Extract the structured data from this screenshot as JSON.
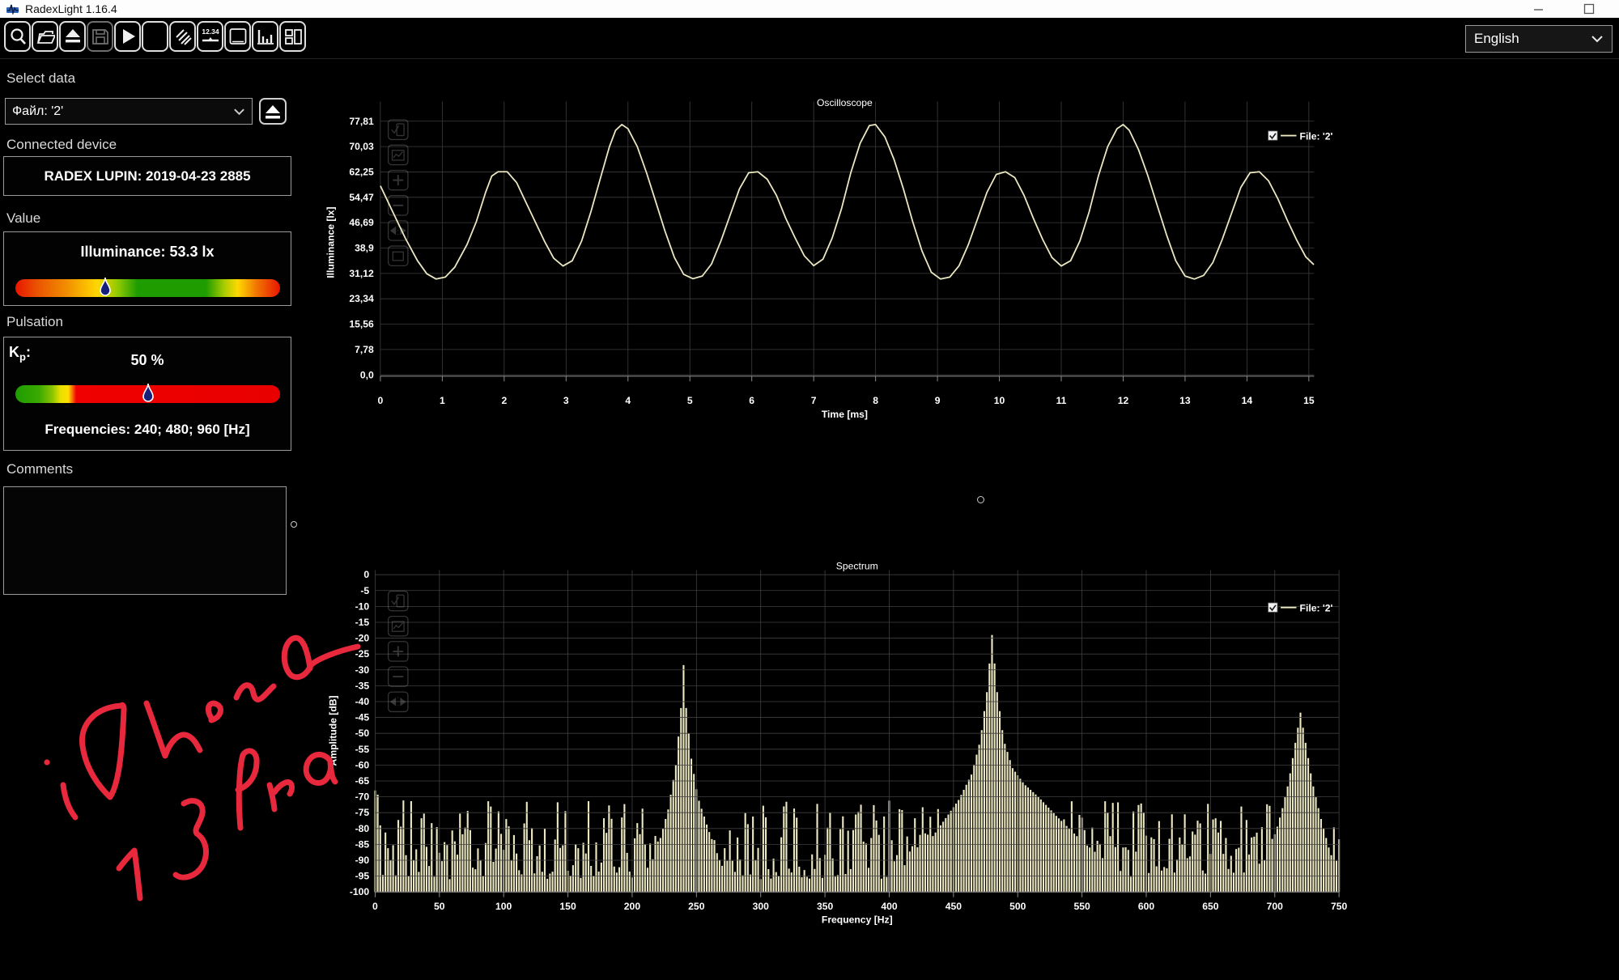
{
  "window": {
    "title": "RadexLight 1.16.4"
  },
  "toolbar": {
    "buttons": [
      {
        "name": "zoom-search",
        "disabled": false
      },
      {
        "name": "open-file",
        "disabled": false
      },
      {
        "name": "eject-device",
        "disabled": false
      },
      {
        "name": "save",
        "disabled": true
      },
      {
        "name": "play",
        "disabled": false
      },
      {
        "name": "waveform-mode",
        "disabled": false
      },
      {
        "name": "hatch-filter",
        "disabled": false
      },
      {
        "name": "value-display",
        "disabled": false,
        "text": "12.34"
      },
      {
        "name": "oscilloscope-view",
        "disabled": false
      },
      {
        "name": "spectrum-view",
        "disabled": false
      },
      {
        "name": "panel-layout",
        "disabled": false
      }
    ],
    "language": {
      "value": "English"
    }
  },
  "sidebar": {
    "select_data_label": "Select data",
    "file_select_value": "Файл: '2'",
    "connected_device_label": "Connected device",
    "device_name": "RADEX LUPIN: 2019-04-23 2885",
    "value_label": "Value",
    "illuminance_text": "Illuminance: 53.3 lx",
    "illuminance_marker_pos": 0.34,
    "pulsation_label": "Pulsation",
    "kp_k": "K",
    "kp_sub": "p",
    "kp_colon": ":",
    "kp_value": "50 %",
    "kp_marker_pos": 0.5,
    "frequencies_text": "Frequencies: 240; 480; 960 [Hz]",
    "comments_label": "Comments",
    "comments_value": ""
  },
  "annotation": {
    "text": "iPhone 13Pro",
    "color": "#e8283c"
  },
  "chart_data": [
    {
      "type": "line",
      "title": "Oscilloscope",
      "xlabel": "Time [ms]",
      "ylabel": "Illuminance [lx]",
      "xlim": [
        0,
        15.1
      ],
      "ylim": [
        0,
        84
      ],
      "grid": true,
      "x_ticks": [
        0,
        1,
        2,
        3,
        4,
        5,
        6,
        7,
        8,
        9,
        10,
        11,
        12,
        13,
        14,
        15
      ],
      "y_tick_values": [
        0,
        7.78,
        15.56,
        23.34,
        31.12,
        38.9,
        46.69,
        54.47,
        62.25,
        70.03,
        77.81
      ],
      "y_tick_labels": [
        "0,0",
        "7,78",
        "15,56",
        "23,34",
        "31,12",
        "38,9",
        "46,69",
        "54,47",
        "62,25",
        "70,03",
        "77,81"
      ],
      "legend": {
        "label": "File: '2'",
        "checked": true,
        "position": "top-right"
      },
      "series_color": "#ece8c2",
      "legend_text_color": "#e7e3b4",
      "points": [
        [
          0,
          58
        ],
        [
          0.2,
          50
        ],
        [
          0.4,
          42
        ],
        [
          0.6,
          35
        ],
        [
          0.75,
          31
        ],
        [
          0.9,
          29.4
        ],
        [
          1.05,
          30
        ],
        [
          1.2,
          33
        ],
        [
          1.4,
          40
        ],
        [
          1.55,
          47
        ],
        [
          1.7,
          56
        ],
        [
          1.8,
          61
        ],
        [
          1.9,
          62.3
        ],
        [
          2.05,
          62.3
        ],
        [
          2.2,
          59
        ],
        [
          2.35,
          53
        ],
        [
          2.5,
          47
        ],
        [
          2.65,
          41
        ],
        [
          2.8,
          35.8
        ],
        [
          2.95,
          33.4
        ],
        [
          3.1,
          35
        ],
        [
          3.25,
          41
        ],
        [
          3.4,
          50
        ],
        [
          3.55,
          60
        ],
        [
          3.7,
          70
        ],
        [
          3.8,
          75
        ],
        [
          3.9,
          76.8
        ],
        [
          4,
          75.5
        ],
        [
          4.15,
          70
        ],
        [
          4.3,
          62
        ],
        [
          4.45,
          53
        ],
        [
          4.6,
          44
        ],
        [
          4.75,
          36
        ],
        [
          4.9,
          30.8
        ],
        [
          5.05,
          29.5
        ],
        [
          5.2,
          30.3
        ],
        [
          5.35,
          34
        ],
        [
          5.5,
          41
        ],
        [
          5.65,
          49
        ],
        [
          5.8,
          57
        ],
        [
          5.95,
          62
        ],
        [
          6.1,
          62.3
        ],
        [
          6.25,
          60
        ],
        [
          6.4,
          55
        ],
        [
          6.55,
          48
        ],
        [
          6.7,
          42
        ],
        [
          6.85,
          36.5
        ],
        [
          7,
          33.5
        ],
        [
          7.15,
          35.5
        ],
        [
          7.3,
          42
        ],
        [
          7.45,
          51
        ],
        [
          7.6,
          62
        ],
        [
          7.75,
          71
        ],
        [
          7.9,
          76.5
        ],
        [
          8,
          76.8
        ],
        [
          8.15,
          73
        ],
        [
          8.3,
          66
        ],
        [
          8.45,
          57
        ],
        [
          8.6,
          47
        ],
        [
          8.75,
          38
        ],
        [
          8.9,
          31.5
        ],
        [
          9.05,
          29.4
        ],
        [
          9.2,
          30
        ],
        [
          9.35,
          33.5
        ],
        [
          9.5,
          40
        ],
        [
          9.65,
          48
        ],
        [
          9.8,
          56
        ],
        [
          9.95,
          61.5
        ],
        [
          10.1,
          62.3
        ],
        [
          10.25,
          60.5
        ],
        [
          10.4,
          55
        ],
        [
          10.55,
          48
        ],
        [
          10.7,
          41.5
        ],
        [
          10.85,
          36
        ],
        [
          11,
          33.4
        ],
        [
          11.15,
          35
        ],
        [
          11.3,
          41
        ],
        [
          11.45,
          50
        ],
        [
          11.6,
          61
        ],
        [
          11.75,
          70
        ],
        [
          11.9,
          75.5
        ],
        [
          12,
          76.8
        ],
        [
          12.1,
          75
        ],
        [
          12.25,
          69
        ],
        [
          12.4,
          61
        ],
        [
          12.55,
          52
        ],
        [
          12.7,
          43
        ],
        [
          12.85,
          35
        ],
        [
          13,
          30.3
        ],
        [
          13.15,
          29.4
        ],
        [
          13.3,
          30.5
        ],
        [
          13.45,
          34.5
        ],
        [
          13.6,
          41.5
        ],
        [
          13.75,
          49.5
        ],
        [
          13.9,
          57.5
        ],
        [
          14.05,
          62
        ],
        [
          14.2,
          62.3
        ],
        [
          14.35,
          59.5
        ],
        [
          14.5,
          54
        ],
        [
          14.65,
          47.5
        ],
        [
          14.8,
          41.5
        ],
        [
          14.95,
          36.2
        ],
        [
          15.08,
          33.8
        ]
      ]
    },
    {
      "type": "bar",
      "title": "Spectrum",
      "xlabel": "Frequency [Hz]",
      "ylabel": "Amplitude [dB]",
      "xlim": [
        0,
        750
      ],
      "ylim": [
        -100,
        0
      ],
      "grid": true,
      "x_ticks": [
        0,
        50,
        100,
        150,
        200,
        250,
        300,
        350,
        400,
        450,
        500,
        550,
        600,
        650,
        700,
        750
      ],
      "y_ticks": [
        0,
        -5,
        -10,
        -15,
        -20,
        -25,
        -30,
        -35,
        -40,
        -45,
        -50,
        -55,
        -60,
        -65,
        -70,
        -75,
        -80,
        -85,
        -90,
        -95,
        -100
      ],
      "legend": {
        "label": "File: '2'",
        "checked": true,
        "position": "top-right"
      },
      "series_color": "#ece8c2",
      "legend_text_color": "#e7e3b4",
      "bar_step_hz": 2,
      "noise_floor_db": [
        -96,
        -71
      ],
      "peaks": [
        {
          "hz": 240,
          "db": -28.5
        },
        {
          "hz": 480,
          "db": -19
        },
        {
          "hz": 720,
          "db": -43.5
        }
      ],
      "envelope": [
        [
          0,
          -68
        ],
        [
          3,
          -70
        ],
        [
          6,
          -97
        ],
        [
          85,
          -97
        ],
        [
          89,
          -71
        ],
        [
          93,
          -97
        ],
        [
          208,
          -97
        ],
        [
          220,
          -86
        ],
        [
          228,
          -74
        ],
        [
          234,
          -60
        ],
        [
          238,
          -42
        ],
        [
          240,
          -28.5
        ],
        [
          242,
          -42
        ],
        [
          246,
          -58
        ],
        [
          251,
          -70
        ],
        [
          259,
          -80
        ],
        [
          268,
          -90
        ],
        [
          276,
          -97
        ],
        [
          408,
          -97
        ],
        [
          424,
          -88
        ],
        [
          440,
          -79
        ],
        [
          454,
          -71
        ],
        [
          464,
          -63
        ],
        [
          471,
          -52
        ],
        [
          476,
          -37
        ],
        [
          480,
          -19
        ],
        [
          484,
          -37
        ],
        [
          489,
          -52
        ],
        [
          496,
          -61
        ],
        [
          505,
          -66
        ],
        [
          516,
          -70
        ],
        [
          530,
          -76
        ],
        [
          550,
          -84
        ],
        [
          574,
          -92
        ],
        [
          596,
          -97
        ],
        [
          678,
          -97
        ],
        [
          694,
          -89
        ],
        [
          704,
          -77
        ],
        [
          711,
          -65
        ],
        [
          716,
          -53
        ],
        [
          720,
          -43.5
        ],
        [
          724,
          -53
        ],
        [
          729,
          -65
        ],
        [
          736,
          -77
        ],
        [
          742,
          -86
        ],
        [
          747,
          -92
        ],
        [
          750,
          -90
        ]
      ]
    }
  ]
}
